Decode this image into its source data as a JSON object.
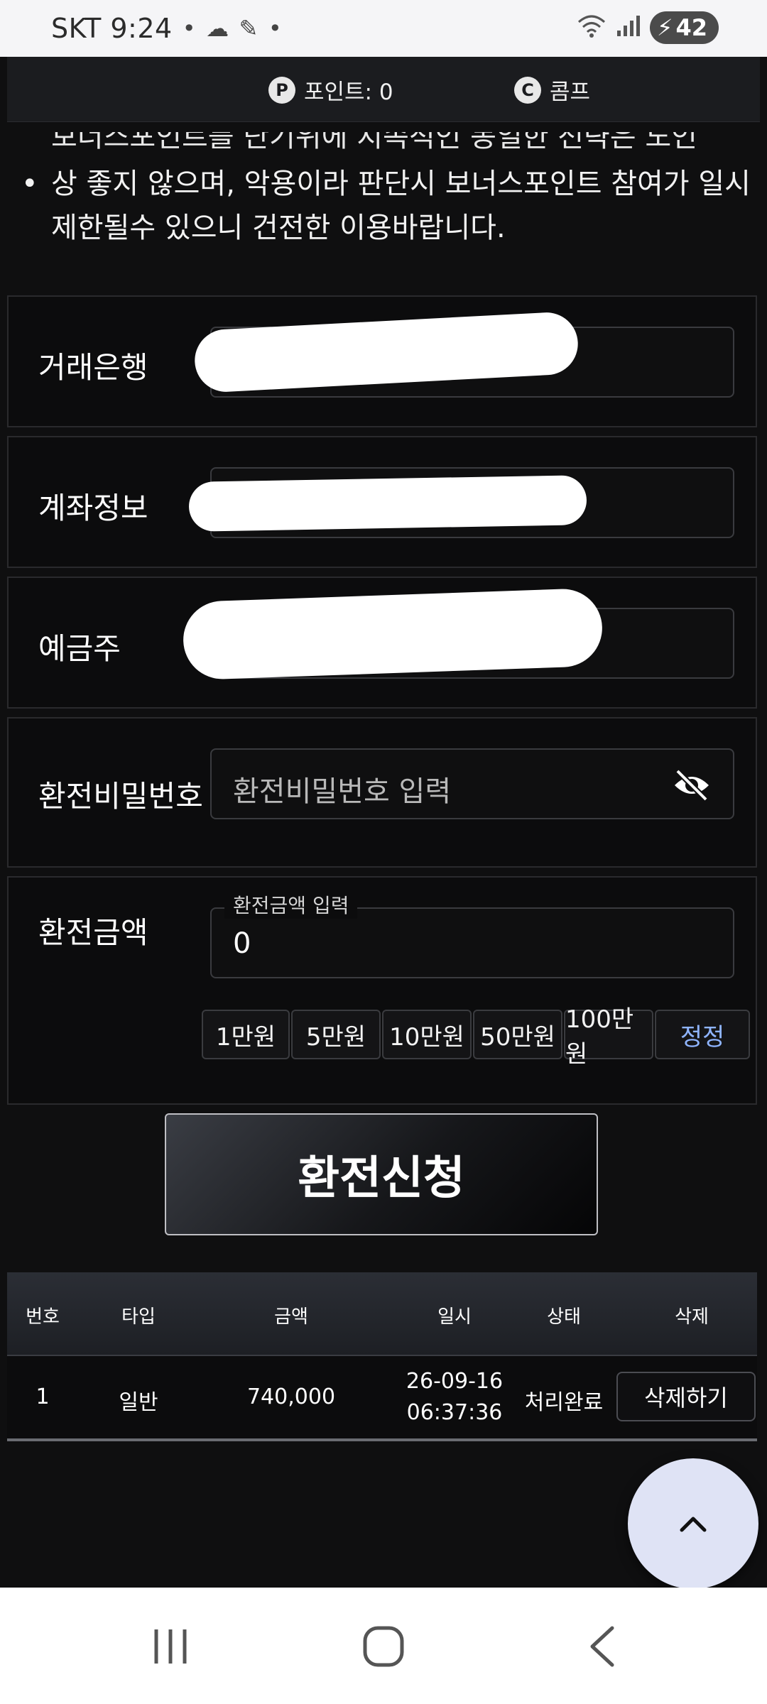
{
  "status_bar": {
    "carrier_time": "SKT 9:24",
    "battery_level": "42",
    "icons": [
      "notification-dot-icon",
      "cloud-icon",
      "pen-icon",
      "wifi-icon",
      "signal-icon",
      "battery-charging-icon"
    ]
  },
  "points_bar": {
    "points_label": "포인트: 0",
    "comp_label": "콤프",
    "points_icon_glyph": "P",
    "comp_icon_glyph": "C"
  },
  "notice": {
    "cut_line": "보너스포인트를 단기위에 지속적인 동일한 전략은 노인",
    "text": "상 좋지 않으며, 악용이라 판단시 보너스포인트 참여가 일시제한될수 있으니 건전한 이용바랍니다."
  },
  "form": {
    "bank_label": "거래은행",
    "account_label": "계좌정보",
    "holder_label": "예금주",
    "password_label": "환전비밀번호",
    "password_placeholder": "환전비밀번호 입력",
    "amount_label": "환전금액",
    "amount_legend": "환전금액 입력",
    "amount_value": "0",
    "quick_amounts": [
      "1만원",
      "5만원",
      "10만원",
      "50만원",
      "100만원"
    ],
    "reset_label": "정정",
    "submit_label": "환전신청"
  },
  "table": {
    "headers": [
      "번호",
      "타입",
      "금액",
      "일시",
      "상태",
      "삭제"
    ],
    "rows": [
      {
        "no": "1",
        "type": "일반",
        "amount": "740,000",
        "date": "26-09-16",
        "time": "06:37:36",
        "status": "처리완료",
        "action": "삭제하기"
      }
    ]
  },
  "colors": {
    "background": "#0f0f10",
    "reset_accent": "#8fb4ff",
    "fab": "#dfe3f5"
  }
}
